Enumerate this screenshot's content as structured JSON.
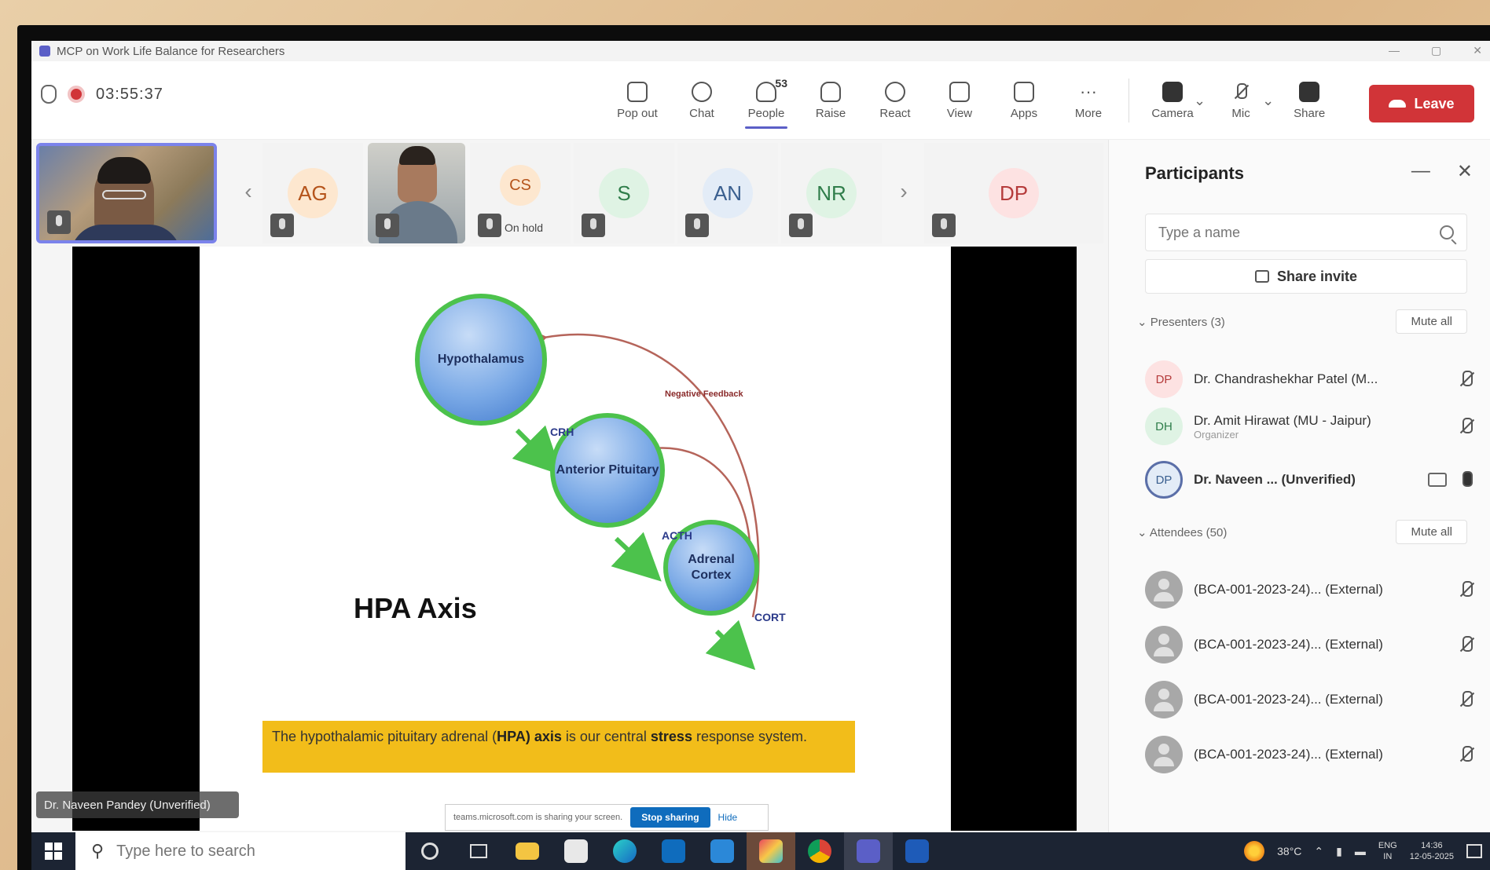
{
  "window": {
    "title": "MCP on Work Life Balance for Researchers"
  },
  "toolbar": {
    "timer": "03:55:37",
    "buttons": [
      {
        "label": "Pop out",
        "icon": "pop-out-icon"
      },
      {
        "label": "Chat",
        "icon": "chat-icon"
      },
      {
        "label": "People",
        "icon": "people-icon",
        "badge": "53",
        "active": true
      },
      {
        "label": "Raise",
        "icon": "raise-hand-icon"
      },
      {
        "label": "React",
        "icon": "react-icon"
      },
      {
        "label": "View",
        "icon": "view-icon"
      },
      {
        "label": "Apps",
        "icon": "apps-icon"
      },
      {
        "label": "More",
        "icon": "more-icon"
      }
    ],
    "camera_label": "Camera",
    "mic_label": "Mic",
    "share_label": "Share",
    "leave_label": "Leave"
  },
  "strip": {
    "tiles": [
      {
        "initials": "AG",
        "bg": "#fde7cf",
        "fg": "#b5541b"
      },
      {
        "initials": "CS",
        "bg": "#fde7cf",
        "fg": "#b5541b",
        "status": "On hold"
      },
      {
        "initials": "S",
        "bg": "#dff3e4",
        "fg": "#2f7d4a"
      },
      {
        "initials": "AN",
        "bg": "#e3ecf7",
        "fg": "#3a5f8f"
      },
      {
        "initials": "NR",
        "bg": "#dff3e4",
        "fg": "#2f7d4a"
      },
      {
        "initials": "DP",
        "bg": "#fde2e2",
        "fg": "#b53b3b"
      }
    ]
  },
  "slide": {
    "nodes": {
      "hypothalamus": "Hypothalamus",
      "anterior_pituitary": "Anterior Pituitary",
      "adrenal_cortex": "Adrenal Cortex"
    },
    "hormones": {
      "crh": "CRH",
      "acth": "ACTH",
      "cort": "CORT"
    },
    "negative_feedback": "Negative Feedback",
    "title": "HPA Axis",
    "caption_pre": "The hypothalamic pituitary adrenal (",
    "caption_bold1": "HPA) axis",
    "caption_mid": " is our central ",
    "caption_bold2": "stress",
    "caption_post": " response system."
  },
  "stage": {
    "presenter_name": "Dr. Naveen Pandey (Unverified)",
    "share_bar_text": "teams.microsoft.com is sharing your screen.",
    "stop_sharing": "Stop sharing",
    "hide": "Hide"
  },
  "participants": {
    "title": "Participants",
    "search_placeholder": "Type a name",
    "share_invite": "Share invite",
    "presenters_label": "Presenters (3)",
    "attendees_label": "Attendees (50)",
    "mute_all": "Mute all",
    "presenters": [
      {
        "initials": "DP",
        "name": "Dr. Chandrashekhar Patel (M...",
        "bg": "#fde2e2",
        "fg": "#b53b3b"
      },
      {
        "initials": "DH",
        "name": "Dr. Amit Hirawat (MU - Jaipur)",
        "role": "Organizer",
        "bg": "#dff3e4",
        "fg": "#2f7d4a"
      },
      {
        "initials": "DP",
        "name": "Dr. Naveen ... (Unverified)",
        "bg": "#e3ecf7",
        "fg": "#3a5f8f"
      }
    ],
    "attendees": [
      {
        "name": "(BCA-001-2023-24)... (External)"
      },
      {
        "name": "(BCA-001-2023-24)... (External)"
      },
      {
        "name": "(BCA-001-2023-24)... (External)"
      },
      {
        "name": "(BCA-001-2023-24)... (External)"
      }
    ]
  },
  "taskbar": {
    "search_placeholder": "Type here to search",
    "temp": "38°C",
    "lang_top": "ENG",
    "lang_bottom": "IN",
    "time": "14:36",
    "date": "12-05-2025"
  }
}
